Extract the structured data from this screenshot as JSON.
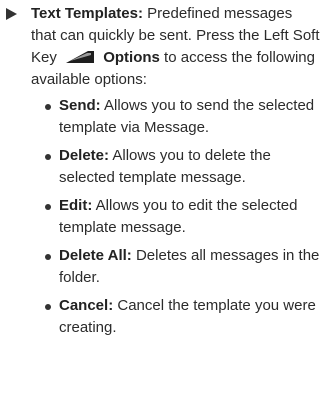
{
  "main_item": {
    "term": "Text Templates:",
    "text_before_icon": "Predefined messages that can quickly be sent. Press the Left Soft Key",
    "icon": "left-soft-key-icon",
    "icon_label": "Options",
    "text_after_icon": "to access the following available options:"
  },
  "options": [
    {
      "term": "Send:",
      "text": "Allows you to send the selected template via Message."
    },
    {
      "term": "Delete:",
      "text": "Allows you to delete the selected template message."
    },
    {
      "term": "Edit:",
      "text": "Allows you to edit the selected template message."
    },
    {
      "term": "Delete All:",
      "text": "Deletes all messages in the folder."
    },
    {
      "term": "Cancel:",
      "text": "Cancel the template you were creating."
    }
  ]
}
